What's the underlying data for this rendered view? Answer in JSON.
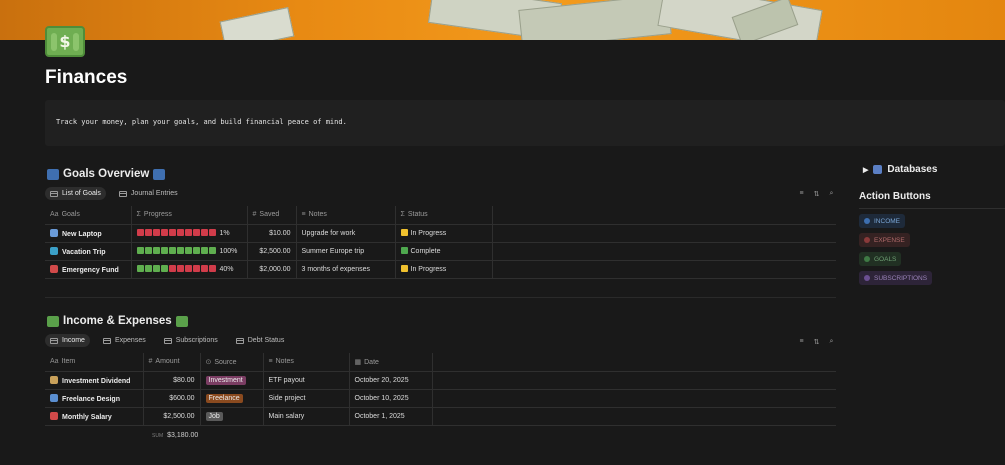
{
  "page": {
    "title": "Finances",
    "callout": "Track your money, plan your goals, and build financial peace of mind."
  },
  "goals": {
    "heading": "Goals Overview",
    "tabs": [
      {
        "label": "List of Goals"
      },
      {
        "label": "Journal Entries"
      }
    ],
    "columns": {
      "goal": "Goals",
      "progress": "Progress",
      "saved": "Saved",
      "notes": "Notes",
      "status": "Status"
    },
    "rows": [
      {
        "name": "New Laptop",
        "progress_pct": "1%",
        "progress": 0.01,
        "saved": "$10.00",
        "notes": "Upgrade for work",
        "status": "In Progress",
        "status_color": "#f0c12e",
        "icon_color": "#6a9bd8"
      },
      {
        "name": "Vacation Trip",
        "progress_pct": "100%",
        "progress": 1.0,
        "saved": "$2,500.00",
        "notes": "Summer Europe trip",
        "status": "Complete",
        "status_color": "#4ea84e",
        "icon_color": "#3ba0c8"
      },
      {
        "name": "Emergency Fund",
        "progress_pct": "40%",
        "progress": 0.4,
        "saved": "$2,000.00",
        "notes": "3 months of expenses",
        "status": "In Progress",
        "status_color": "#f0c12e",
        "icon_color": "#d24a4a"
      }
    ]
  },
  "income": {
    "heading": "Income & Expenses",
    "tabs": [
      {
        "label": "Income"
      },
      {
        "label": "Expenses"
      },
      {
        "label": "Subscriptions"
      },
      {
        "label": "Debt Status"
      }
    ],
    "columns": {
      "item": "Item",
      "amount": "Amount",
      "source": "Source",
      "notes": "Notes",
      "date": "Date"
    },
    "rows": [
      {
        "item": "Investment Dividend",
        "amount": "$80.00",
        "source": "Investment",
        "source_color": "#7b3d63",
        "notes": "ETF payout",
        "date": "October 20, 2025",
        "icon_color": "#c9a15a"
      },
      {
        "item": "Freelance Design",
        "amount": "$600.00",
        "source": "Freelance",
        "source_color": "#8a4a1f",
        "notes": "Side project",
        "date": "October 10, 2025",
        "icon_color": "#5b8fd1"
      },
      {
        "item": "Monthly Salary",
        "amount": "$2,500.00",
        "source": "Job",
        "source_color": "#5a5a5a",
        "notes": "Main salary",
        "date": "October 1, 2025",
        "icon_color": "#d24a4a"
      }
    ],
    "sum_label": "SUM",
    "sum_value": "$3,180.00"
  },
  "sidebar": {
    "databases_label": "Databases",
    "action_title": "Action Buttons",
    "buttons": [
      {
        "label": "INCOME",
        "bg": "#1e2a3a",
        "fg": "#7aa6d6",
        "dot": "#3d6fb0"
      },
      {
        "label": "EXPENSE",
        "bg": "#352222",
        "fg": "#b06a6a",
        "dot": "#8a3a3a"
      },
      {
        "label": "GOALS",
        "bg": "#213023",
        "fg": "#6f9f74",
        "dot": "#3f7a45"
      },
      {
        "label": "SUBSCRIPTIONS",
        "bg": "#2d2438",
        "fg": "#9a83b8",
        "dot": "#6b4f91"
      }
    ]
  },
  "colors": {
    "bar_filled": "#5fae4f",
    "bar_empty": "#d13c4a"
  },
  "icons": {
    "sort": "sort-icon",
    "filter": "filter-icon",
    "search": "search-icon"
  }
}
